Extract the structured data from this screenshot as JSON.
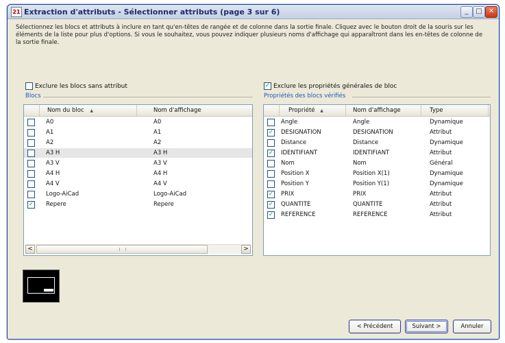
{
  "window": {
    "app_icon": "21",
    "title": "Extraction d'attributs - Sélectionner attributs (page 3 sur 6)"
  },
  "description": "Sélectionnez les blocs et attributs à inclure en tant qu'en-têtes de rangée et de colonne dans la sortie finale. Cliquez avec le bouton droit de la souris sur les éléments de la liste pour plus d'options. Si vous le souhaitez, vous pouvez indiquer plusieurs noms d'affichage qui apparaîtront dans les en-têtes de colonne de la sortie finale.",
  "options": {
    "exclude_blocks_no_attr": {
      "label": "Exclure les blocs sans attribut",
      "checked": false
    },
    "exclude_general_props": {
      "label": "Exclure les propriétés générales de bloc",
      "checked": true
    }
  },
  "blocks": {
    "group_label": "Blocs",
    "headers": {
      "name": "Nom du bloc",
      "sort": "▲",
      "display": "Nom d'affichage"
    },
    "rows": [
      {
        "name": "A0",
        "display": "A0",
        "checked": false
      },
      {
        "name": "A1",
        "display": "A1",
        "checked": false
      },
      {
        "name": "A2",
        "display": "A2",
        "checked": false
      },
      {
        "name": "A3 H",
        "display": "A3 H",
        "checked": false,
        "selected": true
      },
      {
        "name": "A3 V",
        "display": "A3 V",
        "checked": false
      },
      {
        "name": "A4 H",
        "display": "A4 H",
        "checked": false
      },
      {
        "name": "A4 V",
        "display": "A4 V",
        "checked": false
      },
      {
        "name": "Logo-AiCad",
        "display": "Logo-AiCad",
        "checked": false
      },
      {
        "name": "Repere",
        "display": "Repere",
        "checked": true
      }
    ],
    "scroll_left": "<",
    "scroll_right": ">"
  },
  "properties": {
    "group_label": "Propriétés des blocs vérifiés",
    "headers": {
      "property": "Propriété",
      "sort": "▲",
      "display": "Nom d'affichage",
      "type": "Type"
    },
    "rows": [
      {
        "property": "Angle",
        "display": "Angle",
        "type": "Dynamique",
        "checked": false
      },
      {
        "property": "DESIGNATION",
        "display": "DESIGNATION",
        "type": "Attribut",
        "checked": true
      },
      {
        "property": "Distance",
        "display": "Distance",
        "type": "Dynamique",
        "checked": false
      },
      {
        "property": "IDENTIFIANT",
        "display": "IDENTIFIANT",
        "type": "Attribut",
        "checked": true
      },
      {
        "property": "Nom",
        "display": "Nom",
        "type": "Général",
        "checked": false
      },
      {
        "property": "Position X",
        "display": "Position X(1)",
        "type": "Dynamique",
        "checked": false
      },
      {
        "property": "Position Y",
        "display": "Position Y(1)",
        "type": "Dynamique",
        "checked": false
      },
      {
        "property": "PRIX",
        "display": "PRIX",
        "type": "Attribut",
        "checked": true
      },
      {
        "property": "QUANTITE",
        "display": "QUANTITE",
        "type": "Attribut",
        "checked": true
      },
      {
        "property": "REFERENCE",
        "display": "REFERENCE",
        "type": "Attribut",
        "checked": true
      }
    ]
  },
  "buttons": {
    "previous": "< Précédent",
    "next": "Suivant >",
    "cancel": "Annuler"
  },
  "window_controls": {
    "minimize": "_",
    "maximize": "□",
    "close": "✕"
  },
  "colors": {
    "accent": "#1f55c0",
    "check": "#1d9a1d",
    "face": "#ece9d8"
  }
}
